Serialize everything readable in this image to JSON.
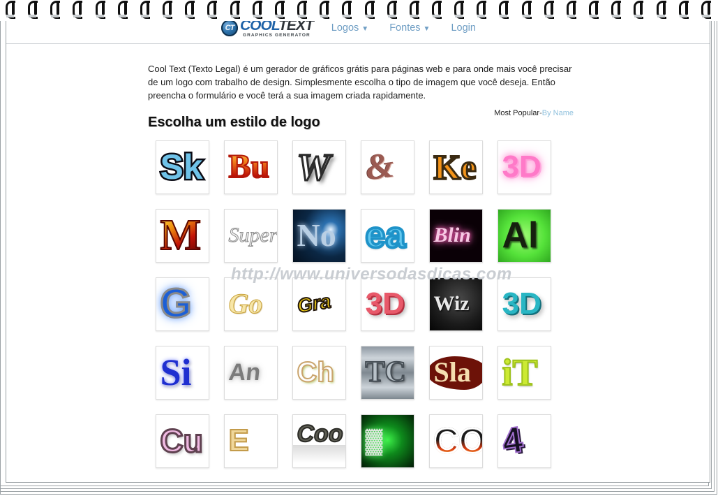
{
  "site": {
    "logo": {
      "badge": "CT",
      "word1": "COOL",
      "word2": "TEXT",
      "tagline": "GRAPHICS GENERATOR"
    },
    "nav": [
      {
        "label": "Logos",
        "caret": "▼"
      },
      {
        "label": "Fontes",
        "caret": "▼"
      },
      {
        "label": "Login",
        "caret": ""
      }
    ]
  },
  "intro": {
    "text": "Cool Text (Texto Legal) é um gerador de gráficos grátis para páginas web e para onde mais você precisar de um logo com trabalho de design. Simplesmente escolha o tipo de imagem que você deseja. Então preencha o formulário e você terá a sua imagem criada rapidamente."
  },
  "section": {
    "title": "Escolha um estilo de logo",
    "sort": {
      "active": "Most Popular",
      "separator": "-",
      "link": "By Name"
    }
  },
  "watermark": {
    "text": "http://www.universodasdicas.com"
  },
  "grid": {
    "styles": [
      {
        "text": "Sk",
        "art": "a-sk",
        "name": "style-sketch-blue"
      },
      {
        "text": "Bu",
        "art": "a-bu",
        "name": "style-burning"
      },
      {
        "text": "W",
        "art": "a-w",
        "name": "style-white-script"
      },
      {
        "text": "&",
        "art": "a-tat",
        "name": "style-tattoo-swirl"
      },
      {
        "text": "Ke",
        "art": "a-ko",
        "name": "style-orange-cartoon"
      },
      {
        "text": "3D",
        "art": "a-3dpink",
        "name": "style-pink-glow"
      },
      {
        "text": "M",
        "art": "a-m",
        "name": "style-molten-lava"
      },
      {
        "text": "Super",
        "art": "a-super",
        "name": "style-super-script"
      },
      {
        "text": "No",
        "art": "a-neon",
        "name": "style-starburst-night"
      },
      {
        "text": "ea",
        "art": "a-ea",
        "name": "style-blue-bubble"
      },
      {
        "text": "Blin",
        "art": "a-blink",
        "name": "style-blinkie-sparkle"
      },
      {
        "text": "Al",
        "art": "a-al",
        "name": "style-green-glow"
      },
      {
        "text": "G",
        "art": "a-g",
        "name": "style-blue-outline-glow"
      },
      {
        "text": "Go",
        "art": "a-go",
        "name": "style-gold-script"
      },
      {
        "text": "Gra",
        "art": "a-graf",
        "name": "style-graffiti-yellow"
      },
      {
        "text": "3D",
        "art": "a-3dred",
        "name": "style-3d-red"
      },
      {
        "text": "Wiz",
        "art": "a-wiz",
        "name": "style-wizard-chalk"
      },
      {
        "text": "3D",
        "art": "a-3dteal",
        "name": "style-3d-teal"
      },
      {
        "text": "Si",
        "art": "a-si",
        "name": "style-simple-blue"
      },
      {
        "text": "An",
        "art": "a-an",
        "name": "style-smoke"
      },
      {
        "text": "Ch",
        "art": "a-ch",
        "name": "style-chrome-outline"
      },
      {
        "text": "TC",
        "art": "a-to",
        "name": "style-metal-plate"
      },
      {
        "text": "Sla",
        "art": "a-sla",
        "name": "style-slab-maroon"
      },
      {
        "text": "iT",
        "art": "a-it",
        "name": "style-lime-gel"
      },
      {
        "text": "Cu",
        "art": "a-cu",
        "name": "style-pink-tube"
      },
      {
        "text": "E",
        "art": "a-e",
        "name": "style-gold-bevel"
      },
      {
        "text": "Coo",
        "art": "a-coo",
        "name": "style-reflection"
      },
      {
        "text": "▓",
        "art": "a-glow",
        "name": "style-green-neon-box"
      },
      {
        "text": "CO",
        "art": "a-co",
        "name": "style-fire-sticker"
      },
      {
        "text": "4",
        "art": "a-4",
        "name": "style-purple-outline-3d"
      }
    ]
  },
  "binding": {
    "ring_count": 32
  }
}
